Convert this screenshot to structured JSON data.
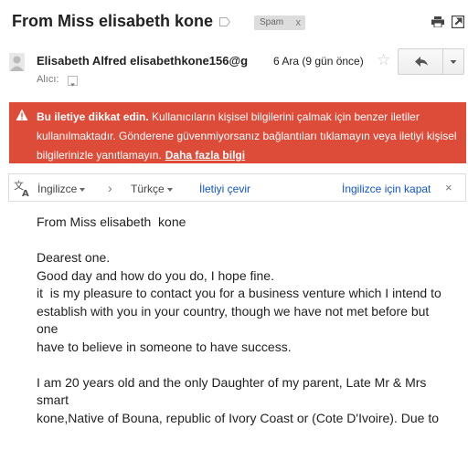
{
  "header": {
    "subject": "From Miss elisabeth kone",
    "spam_label": "Spam",
    "spam_remove": "x"
  },
  "sender": {
    "display": "Elisabeth Alfred elisabethkone156@g",
    "date": "6 Ara (9 gün önce)",
    "to_label": "Alıcı:"
  },
  "warning": {
    "bold": "Bu iletiye dikkat edin.",
    "text": " Kullanıcıların kişisel bilgilerini çalmak için benzer iletiler kullanılmaktadır. Gönderene güvenmiyorsanız bağlantıları tıklamayın veya iletiyi kişisel bilgilerinizle yanıtlamayın.",
    "link": "Daha fazla bilgi"
  },
  "translate": {
    "source_lang": "İngilizce",
    "target_lang": "Türkçe",
    "translate_link": "İletiyi çevir",
    "turn_off": "İngilizce için kapat",
    "close": "×"
  },
  "message": {
    "body": "From Miss elisabeth  kone\n\nDearest one.\nGood day and how do you do, I hope fine.\nit  is my pleasure to contact you for a business venture which I intend to\nestablish with you in your country, though we have not met before but one\nhave to believe in someone to have success.\n\nI am 20 years old and the only Daughter of my parent, Late Mr & Mrs smart\nkone,Native of Bouna, republic of Ivory Coast or (Cote D'Ivoire). Due to"
  },
  "icons": {
    "label": "label-outline-icon",
    "print": "print-icon",
    "new_window": "new-window-icon",
    "reply": "reply-icon",
    "more": "chevron-down-icon",
    "star": "star-icon",
    "warning": "warning-icon",
    "translate": "translate-icon"
  },
  "colors": {
    "warning_bg": "#dd4b39",
    "link": "#1155cc"
  }
}
